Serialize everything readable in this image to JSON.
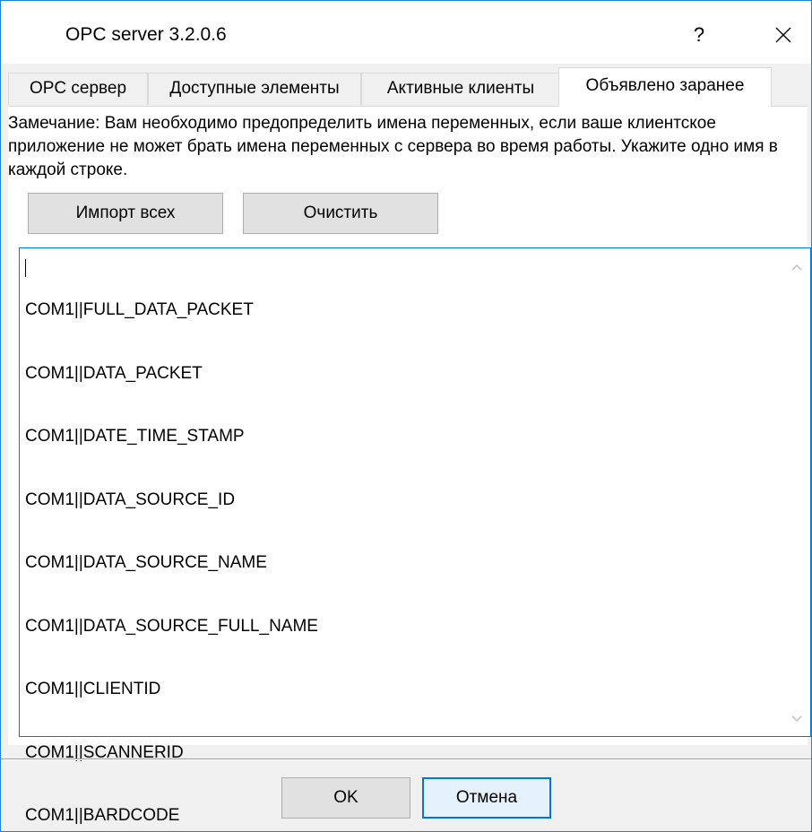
{
  "window": {
    "title": "OPC server 3.2.0.6",
    "help_label": "?"
  },
  "tabs": [
    {
      "label": "OPC сервер",
      "active": false
    },
    {
      "label": "Доступные элементы",
      "active": false
    },
    {
      "label": "Активные клиенты",
      "active": false
    },
    {
      "label": "Объявлено заранее",
      "active": true
    }
  ],
  "note": "Замечание: Вам необходимо предопределить имена переменных, если ваше клиентское приложение не может брать имена переменных с сервера во время работы. Укажите одно имя в каждой строке.",
  "buttons": {
    "import_all": "Импорт всех",
    "clear": "Очистить",
    "ok": "OK",
    "cancel": "Отмена"
  },
  "variables": [
    "COM1||FULL_DATA_PACKET",
    "COM1||DATA_PACKET",
    "COM1||DATE_TIME_STAMP",
    "COM1||DATA_SOURCE_ID",
    "COM1||DATA_SOURCE_NAME",
    "COM1||DATA_SOURCE_FULL_NAME",
    "COM1||CLIENTID",
    "COM1||SCANNERID",
    "COM1||BARDCODE"
  ],
  "icons": {
    "close": "close-icon",
    "scroll_up": "chevron-up-icon",
    "scroll_down": "chevron-down-icon"
  },
  "colors": {
    "accent": "#0078d7",
    "window_border": "#1883d7"
  }
}
